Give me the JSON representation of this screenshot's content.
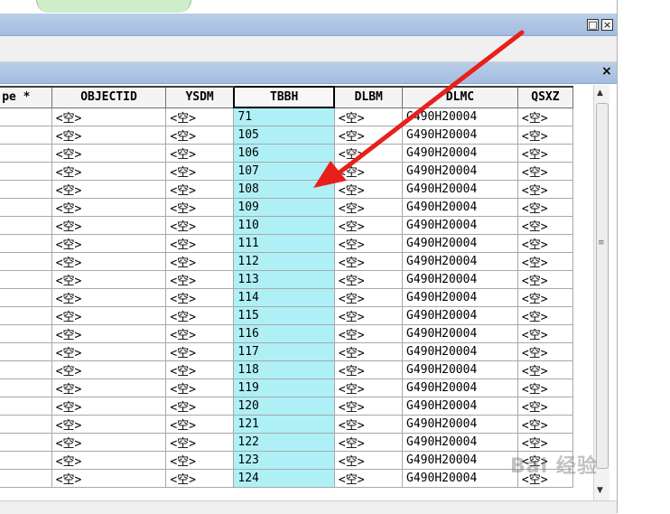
{
  "window": {
    "maximize_icon": "maximize-icon",
    "close_icon": "close-icon",
    "close_glyph": "×"
  },
  "attribute_table": {
    "close_glyph": "×",
    "columns": [
      {
        "key": "type",
        "label": "pe *"
      },
      {
        "key": "objectid",
        "label": "OBJECTID"
      },
      {
        "key": "ysdm",
        "label": "YSDM"
      },
      {
        "key": "tbbh",
        "label": "TBBH",
        "selected": true
      },
      {
        "key": "dlbm",
        "label": "DLBM"
      },
      {
        "key": "dlmc",
        "label": "DLMC"
      },
      {
        "key": "qsxz",
        "label": "QSXZ"
      }
    ],
    "null_text": "<空>",
    "rows": [
      {
        "tbbh": "71",
        "dlmc": "G490H20004"
      },
      {
        "tbbh": "105",
        "dlmc": "G490H20004"
      },
      {
        "tbbh": "106",
        "dlmc": "G490H20004"
      },
      {
        "tbbh": "107",
        "dlmc": "G490H20004"
      },
      {
        "tbbh": "108",
        "dlmc": "G490H20004"
      },
      {
        "tbbh": "109",
        "dlmc": "G490H20004"
      },
      {
        "tbbh": "110",
        "dlmc": "G490H20004"
      },
      {
        "tbbh": "111",
        "dlmc": "G490H20004"
      },
      {
        "tbbh": "112",
        "dlmc": "G490H20004"
      },
      {
        "tbbh": "113",
        "dlmc": "G490H20004"
      },
      {
        "tbbh": "114",
        "dlmc": "G490H20004"
      },
      {
        "tbbh": "115",
        "dlmc": "G490H20004"
      },
      {
        "tbbh": "116",
        "dlmc": "G490H20004"
      },
      {
        "tbbh": "117",
        "dlmc": "G490H20004"
      },
      {
        "tbbh": "118",
        "dlmc": "G490H20004"
      },
      {
        "tbbh": "119",
        "dlmc": "G490H20004"
      },
      {
        "tbbh": "120",
        "dlmc": "G490H20004"
      },
      {
        "tbbh": "121",
        "dlmc": "G490H20004"
      },
      {
        "tbbh": "122",
        "dlmc": "G490H20004"
      },
      {
        "tbbh": "123",
        "dlmc": "G490H20004"
      },
      {
        "tbbh": "124",
        "dlmc": "G490H20004"
      }
    ],
    "highlight_color": "#aff0f6"
  },
  "scrollbar": {
    "up_glyph": "▲",
    "down_glyph": "▼",
    "grip_glyph": "≡"
  },
  "annotation": {
    "arrow_color": "#e8201c"
  },
  "watermark": {
    "text": "Bai 经验"
  }
}
